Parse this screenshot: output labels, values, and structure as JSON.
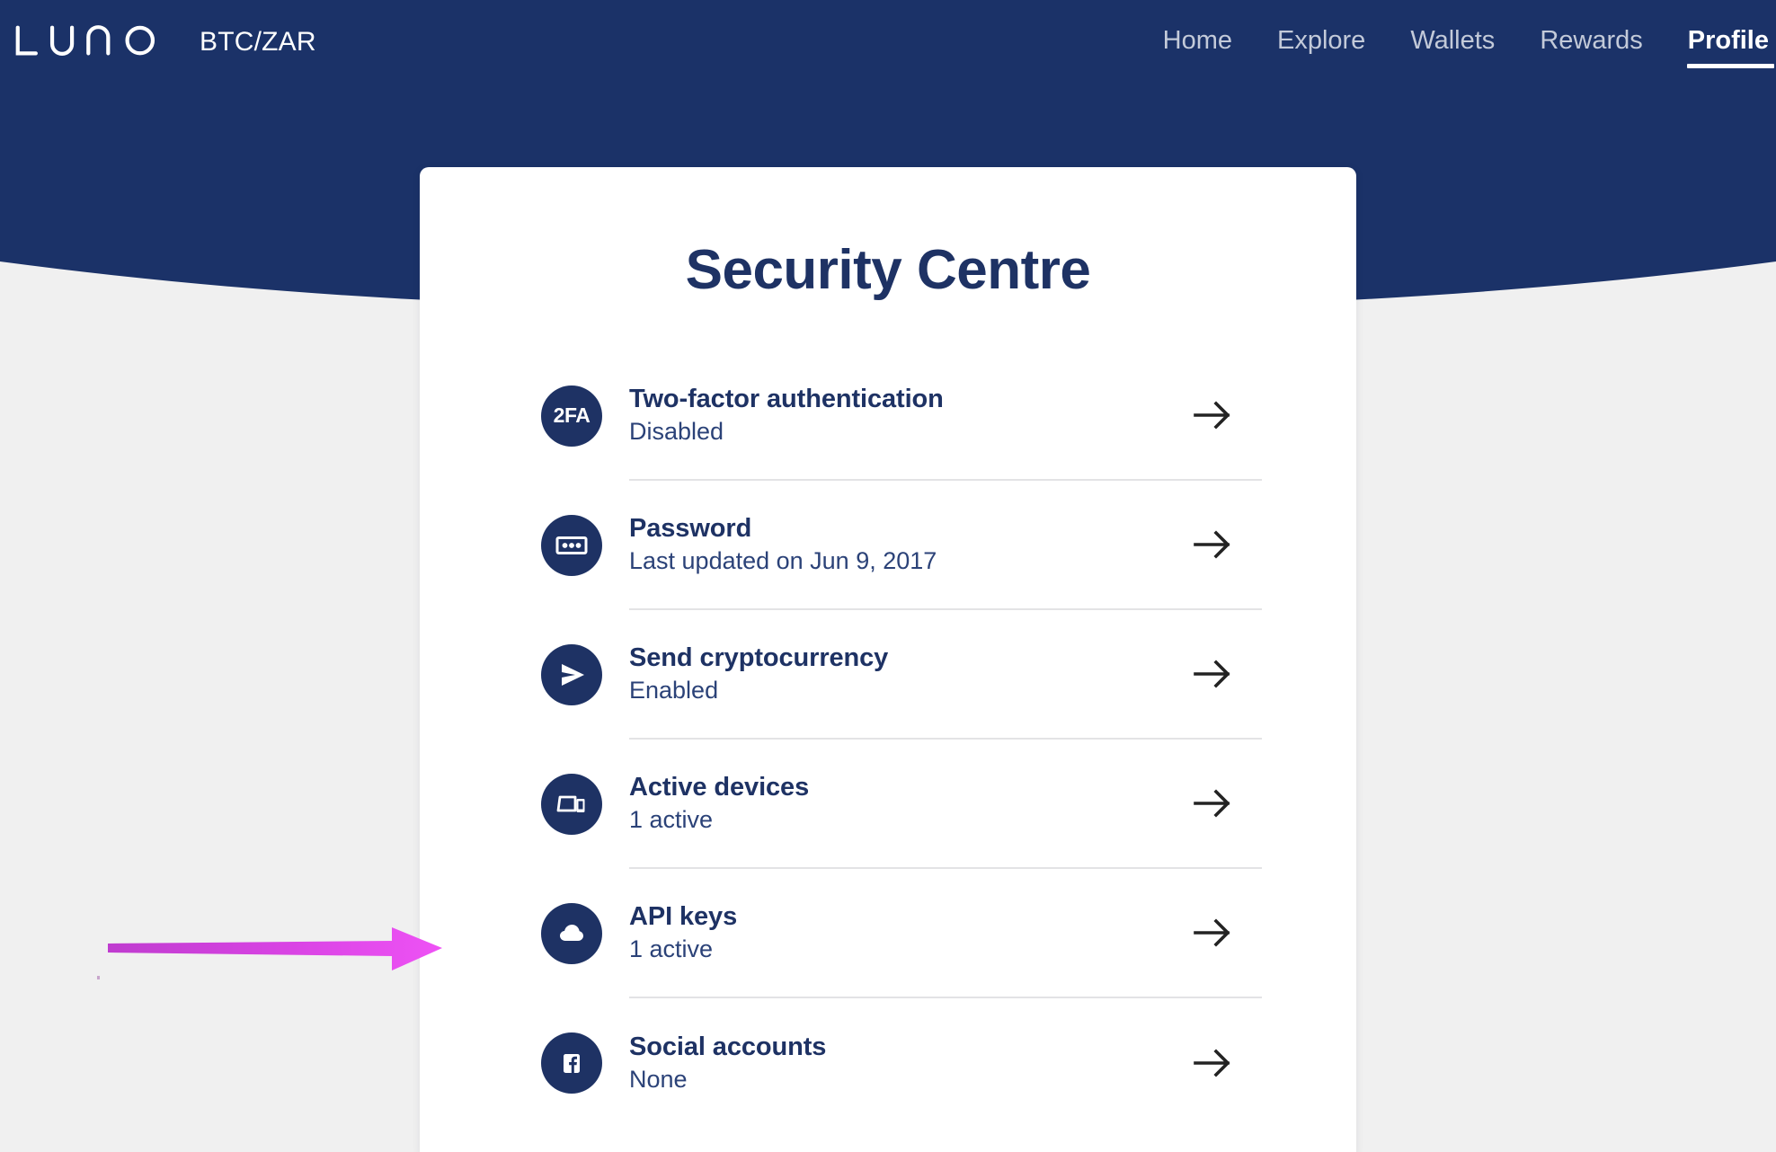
{
  "brand": {
    "logo_text": "LUNO",
    "logo_name": "luno-logo",
    "pair": "BTC/ZAR"
  },
  "nav": {
    "items": [
      {
        "label": "Home",
        "active": false
      },
      {
        "label": "Explore",
        "active": false
      },
      {
        "label": "Wallets",
        "active": false
      },
      {
        "label": "Rewards",
        "active": false
      },
      {
        "label": "Profile",
        "active": true
      }
    ]
  },
  "page": {
    "title": "Security Centre"
  },
  "security_items": [
    {
      "id": "two-factor-authentication",
      "icon": "2fa-icon",
      "icon_label": "2FA",
      "title": "Two-factor authentication",
      "status": "Disabled",
      "chevron": "arrow-right-icon"
    },
    {
      "id": "password",
      "icon": "password-dots-icon",
      "icon_label": "",
      "title": "Password",
      "status": "Last updated on Jun 9, 2017",
      "chevron": "arrow-right-icon"
    },
    {
      "id": "send-cryptocurrency",
      "icon": "send-paper-plane-icon",
      "icon_label": "",
      "title": "Send cryptocurrency",
      "status": "Enabled",
      "chevron": "arrow-right-icon"
    },
    {
      "id": "active-devices",
      "icon": "devices-icon",
      "icon_label": "",
      "title": "Active devices",
      "status": "1 active",
      "chevron": "arrow-right-icon"
    },
    {
      "id": "api-keys",
      "icon": "cloud-icon",
      "icon_label": "",
      "title": "API keys",
      "status": "1 active",
      "chevron": "arrow-right-icon"
    },
    {
      "id": "social-accounts",
      "icon": "facebook-icon",
      "icon_label": "",
      "title": "Social accounts",
      "status": "None",
      "chevron": "arrow-right-icon"
    }
  ],
  "annotation": {
    "type": "arrow",
    "points_to": "api-keys",
    "color_start": "#c13fd1",
    "color_end": "#ee52f5"
  },
  "colors": {
    "brand_blue": "#1e3264",
    "hero_blue": "#1b3268",
    "page_background": "#f0f0f0",
    "card_background": "#ffffff",
    "nav_inactive": "#c3cad9",
    "nav_active": "#ffffff",
    "divider": "#e3e3e5",
    "chevron": "#232323",
    "status_text": "#2b4278"
  }
}
